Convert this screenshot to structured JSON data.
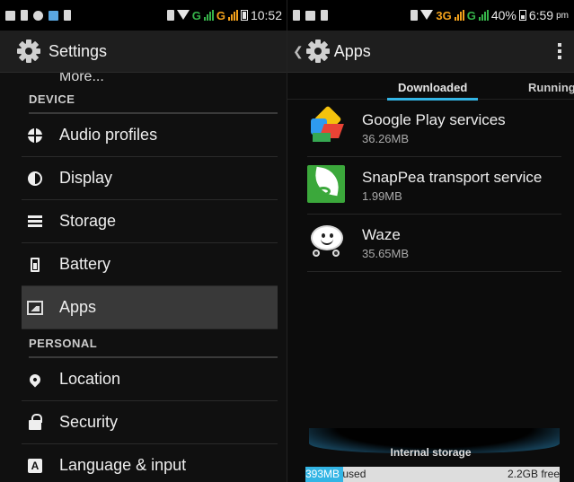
{
  "left": {
    "status": {
      "time": "10:52",
      "network": "G"
    },
    "title": "Settings",
    "partial_item": "More...",
    "sections": [
      {
        "header": "DEVICE",
        "items": [
          {
            "label": "Audio profiles",
            "icon": "audio-profiles-icon"
          },
          {
            "label": "Display",
            "icon": "display-icon"
          },
          {
            "label": "Storage",
            "icon": "storage-icon"
          },
          {
            "label": "Battery",
            "icon": "battery-icon"
          },
          {
            "label": "Apps",
            "icon": "apps-icon",
            "selected": true
          }
        ]
      },
      {
        "header": "PERSONAL",
        "items": [
          {
            "label": "Location",
            "icon": "location-icon"
          },
          {
            "label": "Security",
            "icon": "lock-icon"
          },
          {
            "label": "Language & input",
            "icon": "language-icon"
          }
        ]
      }
    ]
  },
  "right": {
    "status": {
      "time": "6:59",
      "ampm": "pm",
      "battery": "40%",
      "network_3g": "3G",
      "network_g": "G"
    },
    "title": "Apps",
    "tabs": [
      "Downloaded",
      "Running"
    ],
    "apps": [
      {
        "name": "Google Play services",
        "size": "36.26MB",
        "icon": "google-play-services-icon"
      },
      {
        "name": "SnapPea transport service",
        "size": "1.99MB",
        "icon": "snappea-icon"
      },
      {
        "name": "Waze",
        "size": "35.65MB",
        "icon": "waze-icon"
      }
    ],
    "storage": {
      "label": "Internal storage",
      "used": "393MB",
      "used_suffix": "used",
      "free": "2.2GB free",
      "used_fraction": 0.15
    }
  },
  "colors": {
    "accent": "#33b5e5",
    "selected_row": "#393939",
    "background": "#101010"
  }
}
